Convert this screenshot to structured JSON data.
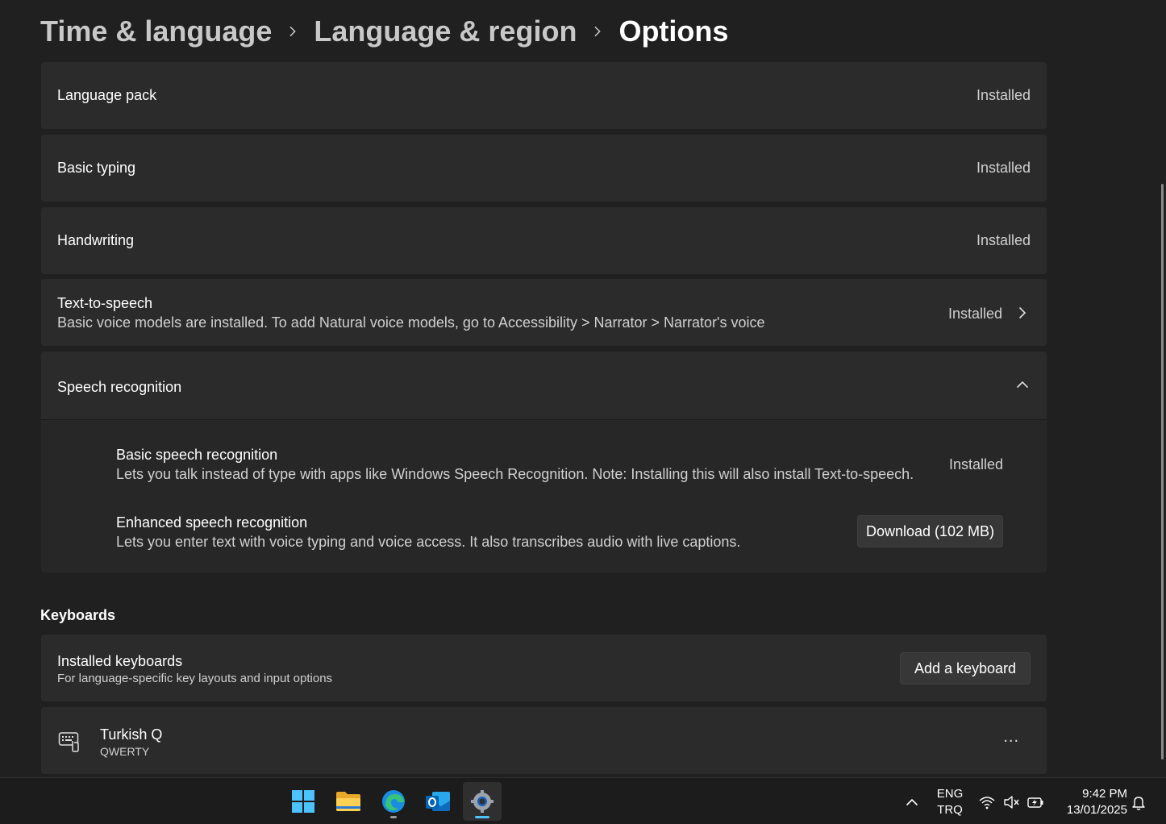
{
  "breadcrumb": {
    "items": [
      "Time & language",
      "Language & region",
      "Options"
    ]
  },
  "features": {
    "language_pack": {
      "title": "Language pack",
      "status": "Installed"
    },
    "basic_typing": {
      "title": "Basic typing",
      "status": "Installed"
    },
    "handwriting": {
      "title": "Handwriting",
      "status": "Installed"
    },
    "tts": {
      "title": "Text-to-speech",
      "desc": "Basic voice models are installed. To add Natural voice models, go to Accessibility > Narrator > Narrator's voice",
      "status": "Installed"
    },
    "speech": {
      "title": "Speech recognition",
      "basic": {
        "title": "Basic speech recognition",
        "desc": "Lets you talk instead of type with apps like Windows Speech Recognition. Note: Installing this will also install Text-to-speech.",
        "status": "Installed"
      },
      "enhanced": {
        "title": "Enhanced speech recognition",
        "desc": "Lets you enter text with voice typing and voice access. It also transcribes audio with live captions.",
        "button": "Download (102 MB)"
      }
    }
  },
  "keyboards": {
    "header": "Keyboards",
    "installed": {
      "title": "Installed keyboards",
      "desc": "For language-specific key layouts and input options",
      "button": "Add a keyboard"
    },
    "items": [
      {
        "name": "Turkish Q",
        "layout": "QWERTY",
        "more": "..."
      }
    ]
  },
  "taskbar": {
    "apps": [
      "start-icon",
      "file-explorer-icon",
      "edge-icon",
      "outlook-icon",
      "settings-icon"
    ],
    "lang_top": "ENG",
    "lang_bottom": "TRQ",
    "time": "9:42 PM",
    "date": "13/01/2025"
  },
  "colors": {
    "background": "#202020",
    "card": "#2b2b2b",
    "accent": "#4cc2ff"
  }
}
